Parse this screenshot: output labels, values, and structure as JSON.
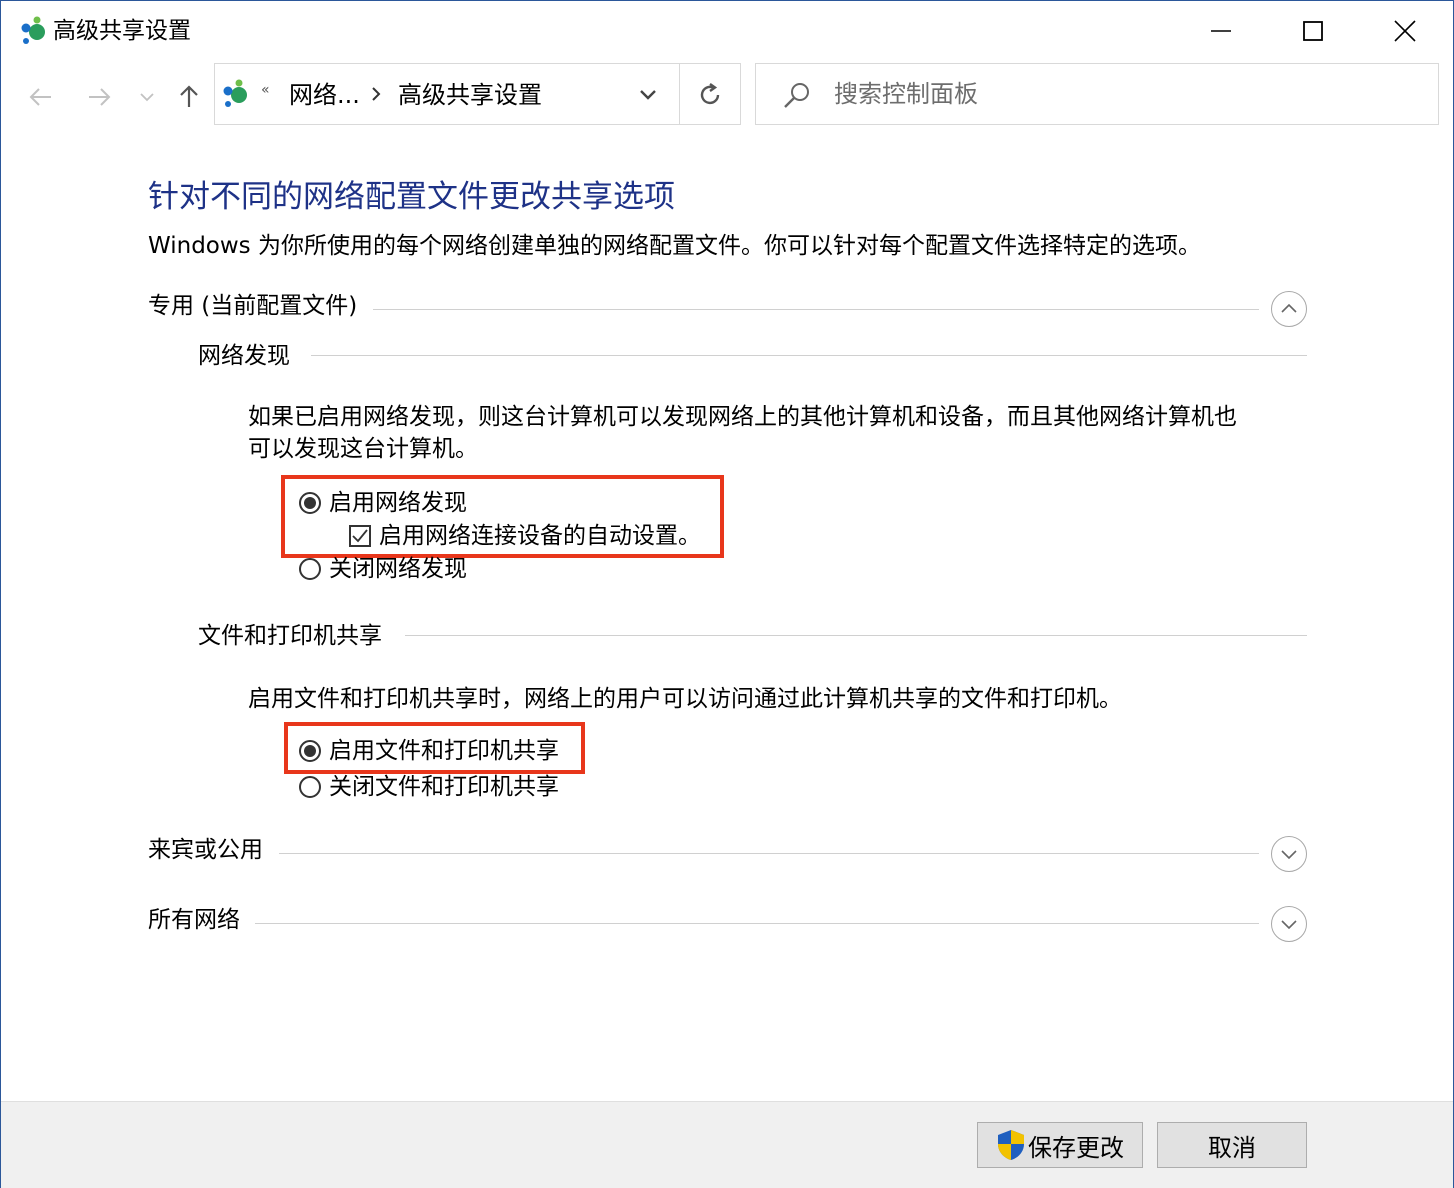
{
  "window": {
    "title": "高级共享设置",
    "icon": "network-sharing-icon"
  },
  "nav": {
    "back_icon": "arrow-left-icon",
    "forward_icon": "arrow-right-icon",
    "recent_icon": "chevron-down-icon",
    "up_icon": "arrow-up-icon",
    "address": {
      "more": "«",
      "crumbs": [
        "网络...",
        "高级共享设置"
      ]
    },
    "search": {
      "placeholder": "搜索控制面板"
    }
  },
  "main": {
    "title": "针对不同的网络配置文件更改共享选项",
    "description": "Windows 为你所使用的每个网络创建单独的网络配置文件。你可以针对每个配置文件选择特定的选项。",
    "profiles": [
      {
        "label": "专用 (当前配置文件)",
        "expanded": true,
        "sections": [
          {
            "heading": "网络发现",
            "description_line1": "如果已启用网络发现，则这台计算机可以发现网络上的其他计算机和设备，而且其他网络计算机也",
            "description_line2": "可以发现这台计算机。",
            "options": [
              {
                "label": "启用网络发现",
                "selected": true
              },
              {
                "label": "关闭网络发现",
                "selected": false
              }
            ],
            "checkbox": {
              "label": "启用网络连接设备的自动设置。",
              "checked": true
            }
          },
          {
            "heading": "文件和打印机共享",
            "description_line1": "启用文件和打印机共享时，网络上的用户可以访问通过此计算机共享的文件和打印机。",
            "options": [
              {
                "label": "启用文件和打印机共享",
                "selected": true
              },
              {
                "label": "关闭文件和打印机共享",
                "selected": false
              }
            ]
          }
        ]
      },
      {
        "label": "来宾或公用",
        "expanded": false
      },
      {
        "label": "所有网络",
        "expanded": false
      }
    ]
  },
  "footer": {
    "save_label": "保存更改",
    "cancel_label": "取消"
  },
  "colors": {
    "title_blue": "#1e3287",
    "highlight_red": "#e8361b",
    "footer_bg": "#f0f0f0"
  }
}
